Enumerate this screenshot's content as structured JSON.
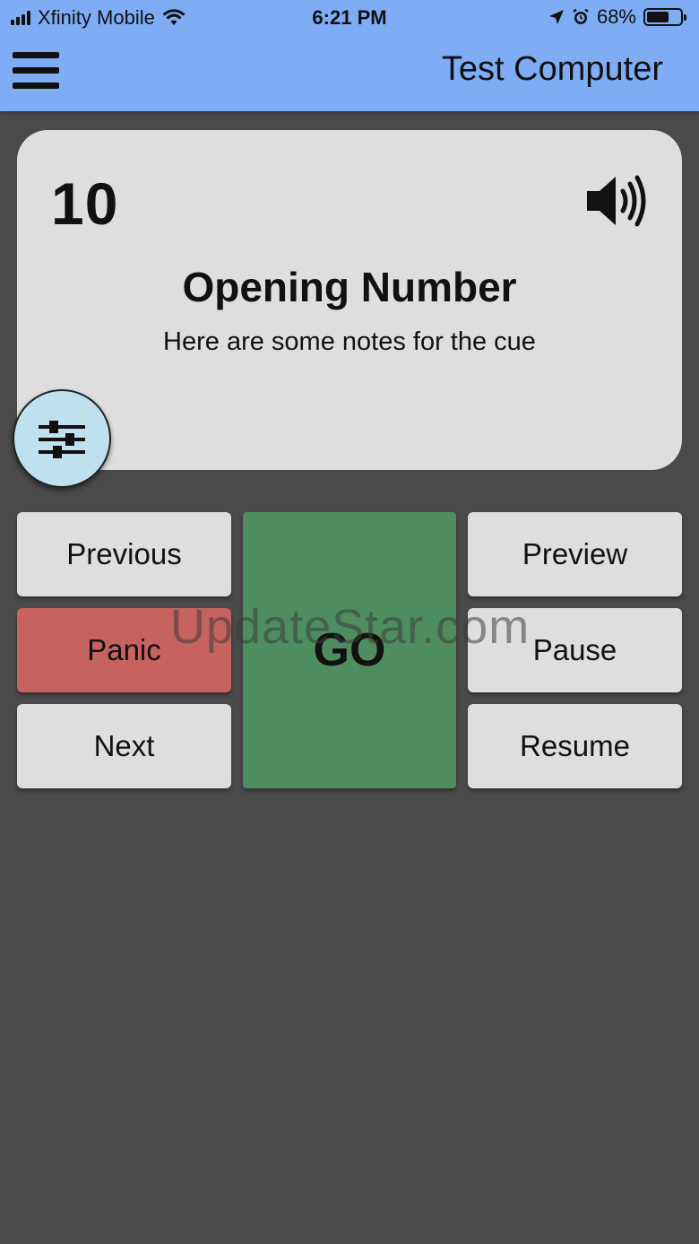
{
  "status_bar": {
    "carrier": "Xfinity Mobile",
    "time": "6:21 PM",
    "battery_percent": "68%",
    "battery_level": 0.68,
    "icons": [
      "signal-icon",
      "wifi-icon",
      "location-icon",
      "alarm-icon",
      "battery-icon"
    ]
  },
  "header": {
    "menu_icon": "hamburger-menu-icon",
    "title": "Test Computer"
  },
  "cue": {
    "number": "10",
    "name": "Opening Number",
    "notes": "Here are some notes for the cue",
    "audio_icon": "speaker-volume-icon",
    "settings_icon": "sliders-icon"
  },
  "controls": {
    "previous": "Previous",
    "panic": "Panic",
    "next": "Next",
    "go": "GO",
    "preview": "Preview",
    "pause": "Pause",
    "resume": "Resume"
  },
  "watermark": "UpdateStar.com",
  "colors": {
    "header_bg": "#7fadf5",
    "background": "#4a4a4a",
    "card_bg": "#dedede",
    "panic_bg": "#c6625f",
    "go_bg": "#4e8e5e",
    "fab_bg": "#bfe0ee"
  }
}
